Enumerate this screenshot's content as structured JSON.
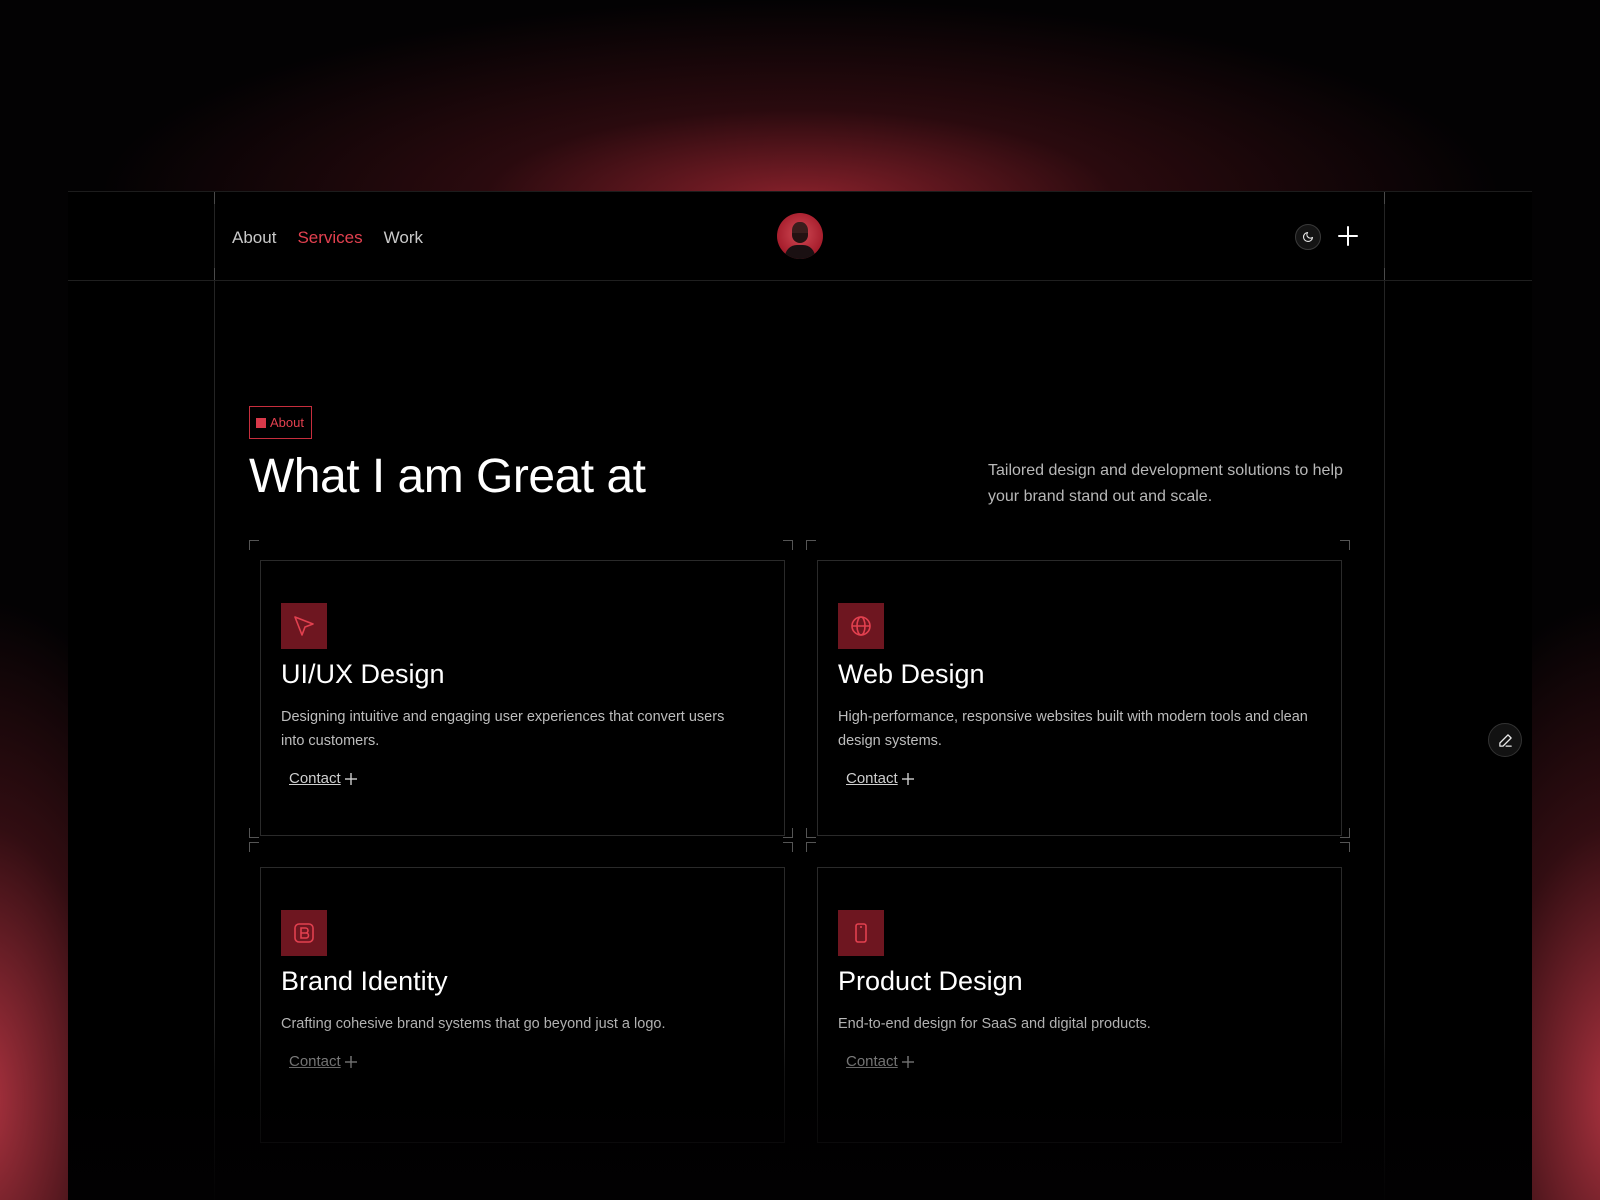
{
  "nav": {
    "items": [
      {
        "label": "About",
        "active": false
      },
      {
        "label": "Services",
        "active": true
      },
      {
        "label": "Work",
        "active": false
      }
    ]
  },
  "header": {
    "theme_icon": "moon-icon",
    "menu_icon": "plus-icon"
  },
  "section": {
    "tag": "About",
    "heading": "What I am Great at",
    "subtitle": "Tailored design and development solutions to help your brand stand out and scale."
  },
  "services": [
    {
      "icon": "cursor-arrow-icon",
      "title": "UI/UX Design",
      "description": "Designing intuitive and engaging user experiences that convert users into customers.",
      "cta": "Contact"
    },
    {
      "icon": "globe-icon",
      "title": "Web Design",
      "description": "High-performance, responsive websites built with modern tools and clean design systems.",
      "cta": "Contact"
    },
    {
      "icon": "brand-b-icon",
      "title": "Brand Identity",
      "description": "Crafting cohesive brand systems that go beyond just a logo.",
      "cta": "Contact"
    },
    {
      "icon": "mobile-phone-icon",
      "title": "Product Design",
      "description": "End-to-end design for SaaS and digital products.",
      "cta": "Contact"
    }
  ],
  "floating": {
    "edit_icon": "pencil-icon"
  },
  "colors": {
    "accent": "#e2404f",
    "icon_box": "#6e1620",
    "background": "#000000"
  }
}
